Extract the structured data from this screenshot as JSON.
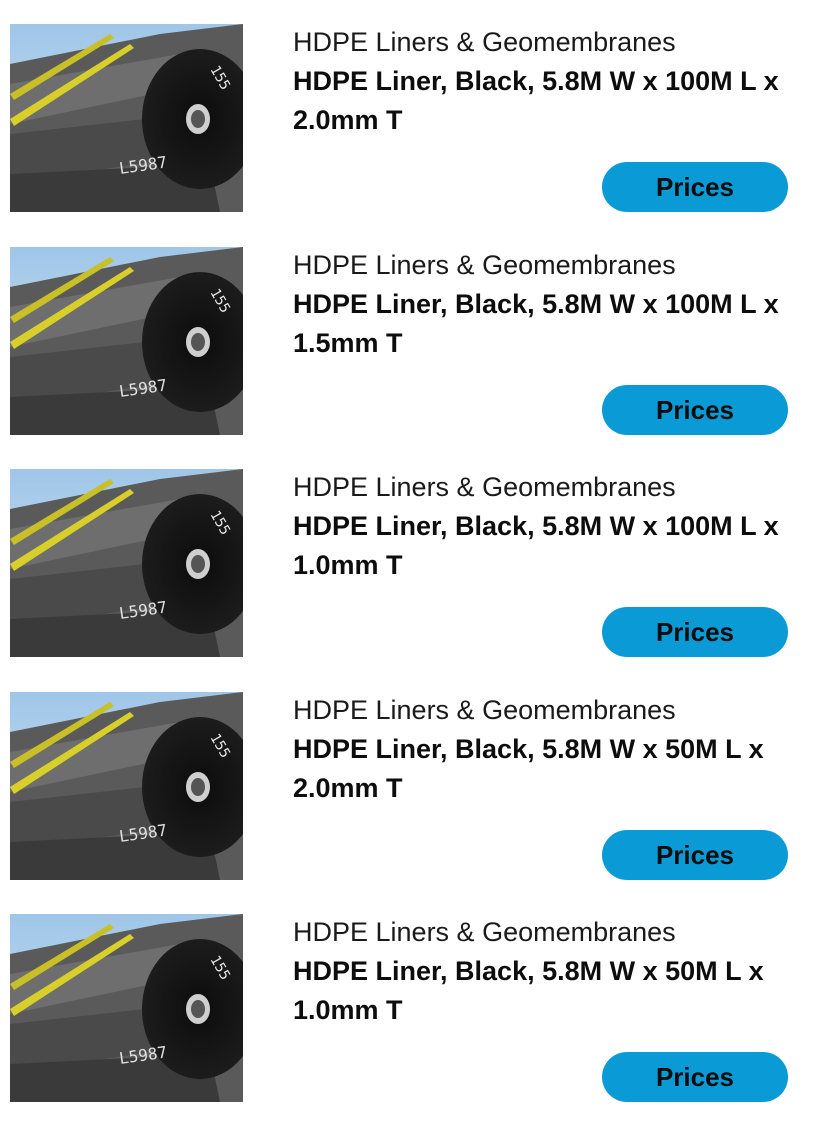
{
  "products": [
    {
      "category": "HDPE Liners & Geomembranes",
      "title": "HDPE Liner, Black, 5.8M W x 100M L x 2.0mm T",
      "button_label": "Prices",
      "image_icon": "hdpe-liner-rolls-photo"
    },
    {
      "category": "HDPE Liners & Geomembranes",
      "title": "HDPE Liner, Black, 5.8M W x 100M L x 1.5mm T",
      "button_label": "Prices",
      "image_icon": "hdpe-liner-rolls-photo"
    },
    {
      "category": "HDPE Liners & Geomembranes",
      "title": "HDPE Liner, Black, 5.8M W x 100M L x 1.0mm T",
      "button_label": "Prices",
      "image_icon": "hdpe-liner-rolls-photo"
    },
    {
      "category": "HDPE Liners & Geomembranes",
      "title": "HDPE Liner, Black, 5.8M W x 50M L x 2.0mm T",
      "button_label": "Prices",
      "image_icon": "hdpe-liner-rolls-photo"
    },
    {
      "category": "HDPE Liners & Geomembranes",
      "title": "HDPE Liner, Black, 5.8M W x 50M L x 1.0mm T",
      "button_label": "Prices",
      "image_icon": "hdpe-liner-rolls-photo"
    }
  ],
  "colors": {
    "button_background": "#0a9ad6",
    "button_text": "#0d0d0d",
    "text": "#111111"
  }
}
